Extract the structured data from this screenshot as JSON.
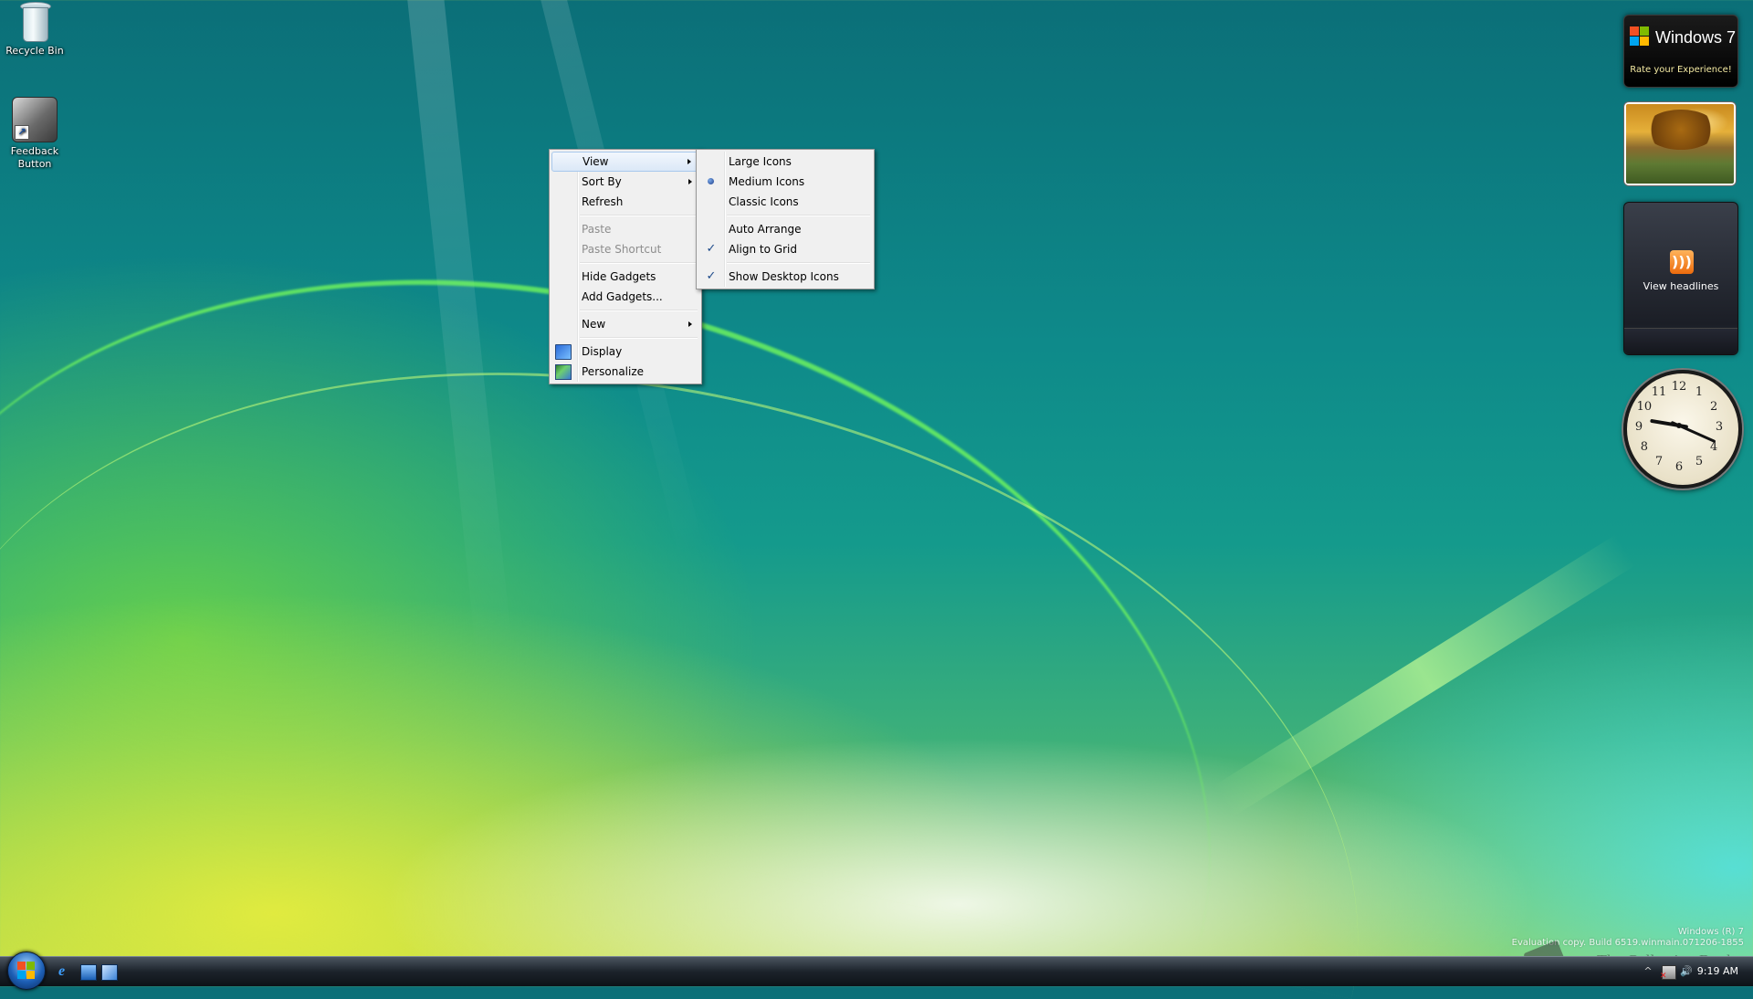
{
  "desktop_icons": [
    {
      "label": "Recycle Bin",
      "icon": "recycle-bin-icon"
    },
    {
      "label": "Feedback\nButton",
      "label_line1": "Feedback",
      "label_line2": "Button",
      "icon": "feedback-shortcut-icon"
    }
  ],
  "context_menu": {
    "items": [
      {
        "label": "View",
        "submenu": true,
        "highlighted": true
      },
      {
        "label": "Sort By",
        "submenu": true
      },
      {
        "label": "Refresh"
      },
      {
        "label": "Paste",
        "disabled": true
      },
      {
        "label": "Paste Shortcut",
        "disabled": true
      },
      {
        "label": "Hide Gadgets"
      },
      {
        "label": "Add Gadgets..."
      },
      {
        "label": "New",
        "submenu": true
      },
      {
        "label": "Display",
        "icon": "display-icon"
      },
      {
        "label": "Personalize",
        "icon": "personalize-icon"
      }
    ]
  },
  "view_submenu": {
    "items": [
      {
        "label": "Large Icons"
      },
      {
        "label": "Medium Icons",
        "selected": true
      },
      {
        "label": "Classic Icons"
      },
      {
        "label": "Auto Arrange"
      },
      {
        "label": "Align to Grid",
        "checked": true
      },
      {
        "label": "Show Desktop Icons",
        "checked": true
      }
    ]
  },
  "gadgets": {
    "windows7": {
      "title": "Windows 7",
      "subtitle": "Rate your Experience!"
    },
    "feed": {
      "label": "View headlines"
    },
    "clock": {
      "time": "9:19",
      "numerals": [
        "12",
        "1",
        "2",
        "3",
        "4",
        "5",
        "6",
        "7",
        "8",
        "9",
        "10",
        "11"
      ]
    }
  },
  "watermark": {
    "line1": "Windows (R) 7",
    "line2": "Evaluation copy. Build 6519.winmain.071206-1855",
    "brand": "The Collection Book"
  },
  "taskbar": {
    "clock": "9:19 AM",
    "quick_launch": [
      "internet-explorer-icon",
      "show-desktop-icon",
      "switch-windows-icon"
    ]
  },
  "colors": {
    "menu_bg": "#f0f0f0",
    "menu_highlight": "#dbe8f7",
    "taskbar": "#1c232b"
  }
}
